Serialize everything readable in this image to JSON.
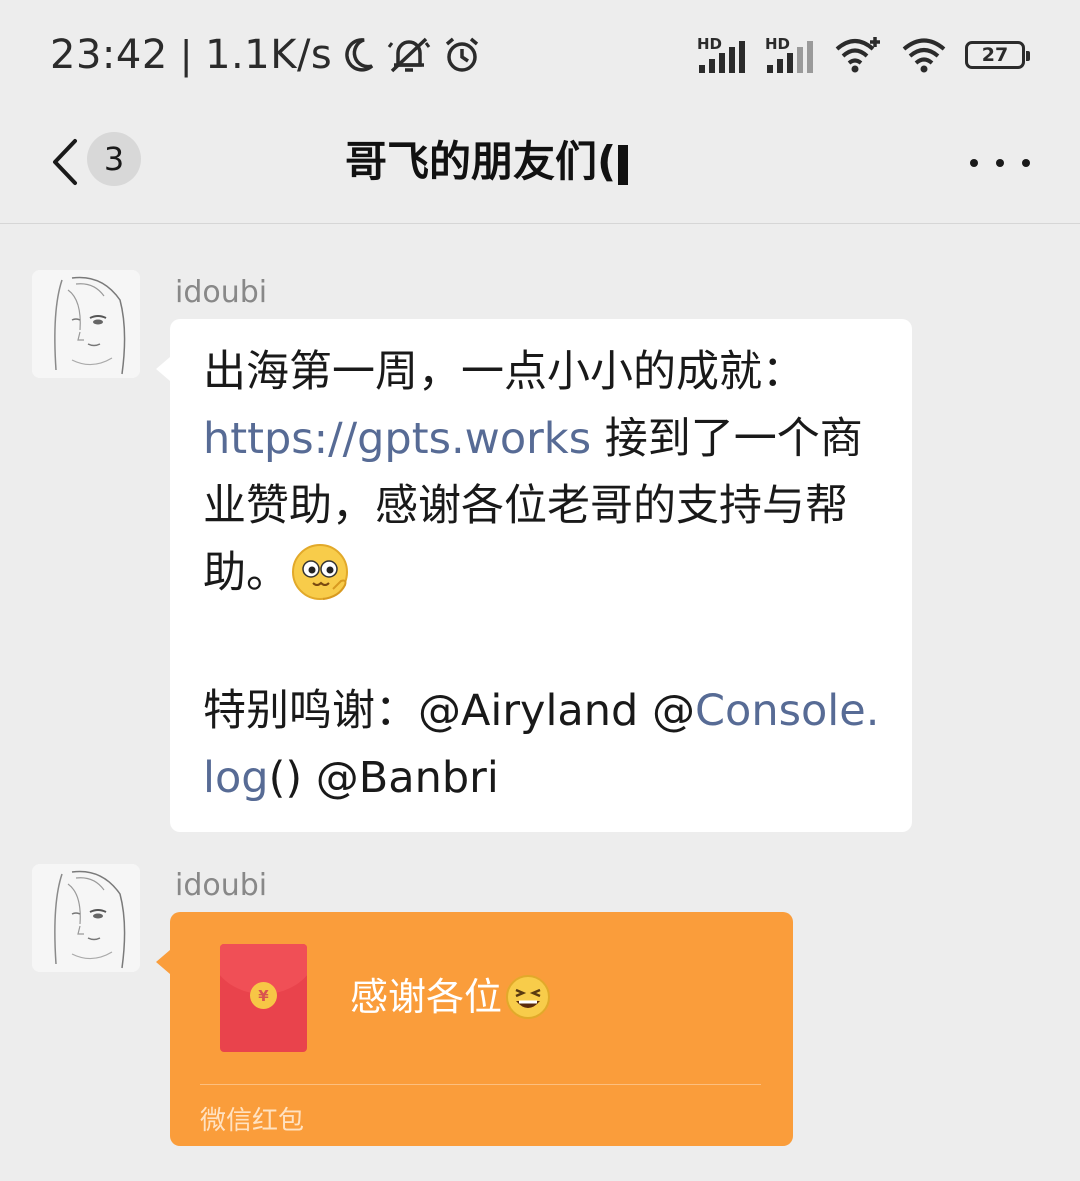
{
  "status_bar": {
    "time": "23:42",
    "network_speed": "1.1K/s",
    "icons": [
      "moon-icon",
      "vibrate-off-icon",
      "alarm-icon",
      "hd-signal-icon",
      "hd-signal-icon",
      "wifi-plus-icon",
      "wifi-icon"
    ],
    "battery": "27"
  },
  "header": {
    "unread_count": "3",
    "title": "哥飞的朋友们(",
    "back_icon": "chevron-left-icon",
    "more_icon": "more-dots-icon"
  },
  "messages": [
    {
      "sender": "idoubi",
      "line1": "出海第一周，一点小小的成就：",
      "link": "https://gpts.works",
      "line2_rest": " 接到了一个商",
      "line3": "业赞助，感谢各位老哥的支持与帮",
      "line4": "助。",
      "emoji": "thinking-face-emoji",
      "thanks_prefix": "特别鸣谢：@Airyland @",
      "mention_link_a": "Console.",
      "mention_link_b": "log",
      "thanks_suffix": "() @Banbri"
    },
    {
      "sender": "idoubi",
      "type": "red-packet",
      "title": "感谢各位",
      "emoji": "laughing-face-emoji",
      "footer": "微信红包",
      "coin_symbol": "¥"
    }
  ],
  "colors": {
    "background": "#ededed",
    "bubble": "#ffffff",
    "link": "#576b95",
    "red_packet": "#fa9d3b",
    "envelope": "#e9434c"
  }
}
